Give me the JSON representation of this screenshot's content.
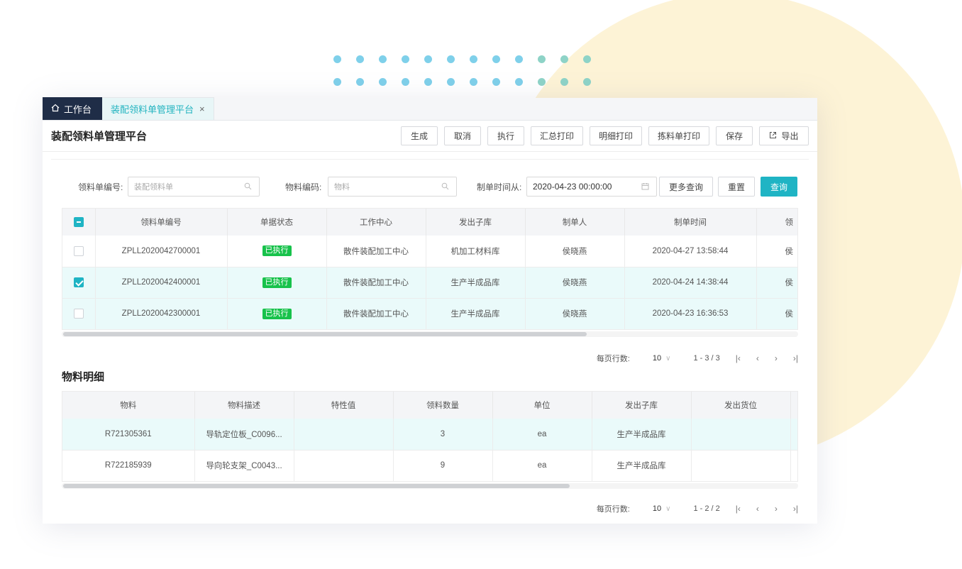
{
  "tabs": {
    "home_label": "工作台",
    "active_label": "装配领料单管理平台",
    "close_glyph": "×"
  },
  "header": {
    "title": "装配领料单管理平台",
    "buttons": [
      "生成",
      "取消",
      "执行",
      "汇总打印",
      "明细打印",
      "拣料单打印",
      "保存"
    ],
    "export_label": "导出"
  },
  "search": {
    "order_no_label": "领料单编号:",
    "order_no_placeholder": "装配领料单",
    "material_label": "物料编码:",
    "material_placeholder": "物料",
    "time_label": "制单时间从:",
    "time_value": "2020-04-23 00:00:00",
    "more_label": "更多查询",
    "reset_label": "重置",
    "query_label": "查询"
  },
  "orders": {
    "columns": [
      "领料单编号",
      "单据状态",
      "工作中心",
      "发出子库",
      "制单人",
      "制单时间",
      "领"
    ],
    "rows": [
      {
        "checked": false,
        "order_no": "ZPLL2020042700001",
        "status": "已执行",
        "work_center": "散件装配加工中心",
        "warehouse": "机加工材料库",
        "creator": "侯晓燕",
        "created_at": "2020-04-27 13:58:44",
        "extra": "侯"
      },
      {
        "checked": true,
        "order_no": "ZPLL2020042400001",
        "status": "已执行",
        "work_center": "散件装配加工中心",
        "warehouse": "生产半成品库",
        "creator": "侯晓燕",
        "created_at": "2020-04-24 14:38:44",
        "extra": "侯"
      },
      {
        "checked": false,
        "order_no": "ZPLL2020042300001",
        "status": "已执行",
        "work_center": "散件装配加工中心",
        "warehouse": "生产半成品库",
        "creator": "侯晓燕",
        "created_at": "2020-04-23 16:36:53",
        "extra": "侯"
      }
    ],
    "pager": {
      "rows_label": "每页行数:",
      "page_size": "10",
      "range": "1 - 3 / 3"
    }
  },
  "details": {
    "title": "物料明细",
    "columns": [
      "物料",
      "物料描述",
      "特性值",
      "领料数量",
      "单位",
      "发出子库",
      "发出货位"
    ],
    "rows": [
      {
        "material": "R721305361",
        "desc": "导轨定位板_C0096...",
        "attr": "",
        "qty": "3",
        "unit": "ea",
        "warehouse": "生产半成品库",
        "location": ""
      },
      {
        "material": "R722185939",
        "desc": "导向轮支架_C0043...",
        "attr": "",
        "qty": "9",
        "unit": "ea",
        "warehouse": "生产半成品库",
        "location": ""
      }
    ],
    "pager": {
      "rows_label": "每页行数:",
      "page_size": "10",
      "range": "1 - 2 / 2"
    }
  },
  "icons": {
    "home": "home-icon",
    "close": "close-icon",
    "export": "export-icon",
    "search": "search-icon",
    "calendar": "calendar-icon",
    "first": "⏮",
    "prev": "‹",
    "next": "›",
    "last": "⏭"
  },
  "colors": {
    "accent": "#1fb4c4",
    "nav_dark": "#1f2d47",
    "status_green": "#17c24b",
    "bg_circle": "#fdf3d6"
  }
}
